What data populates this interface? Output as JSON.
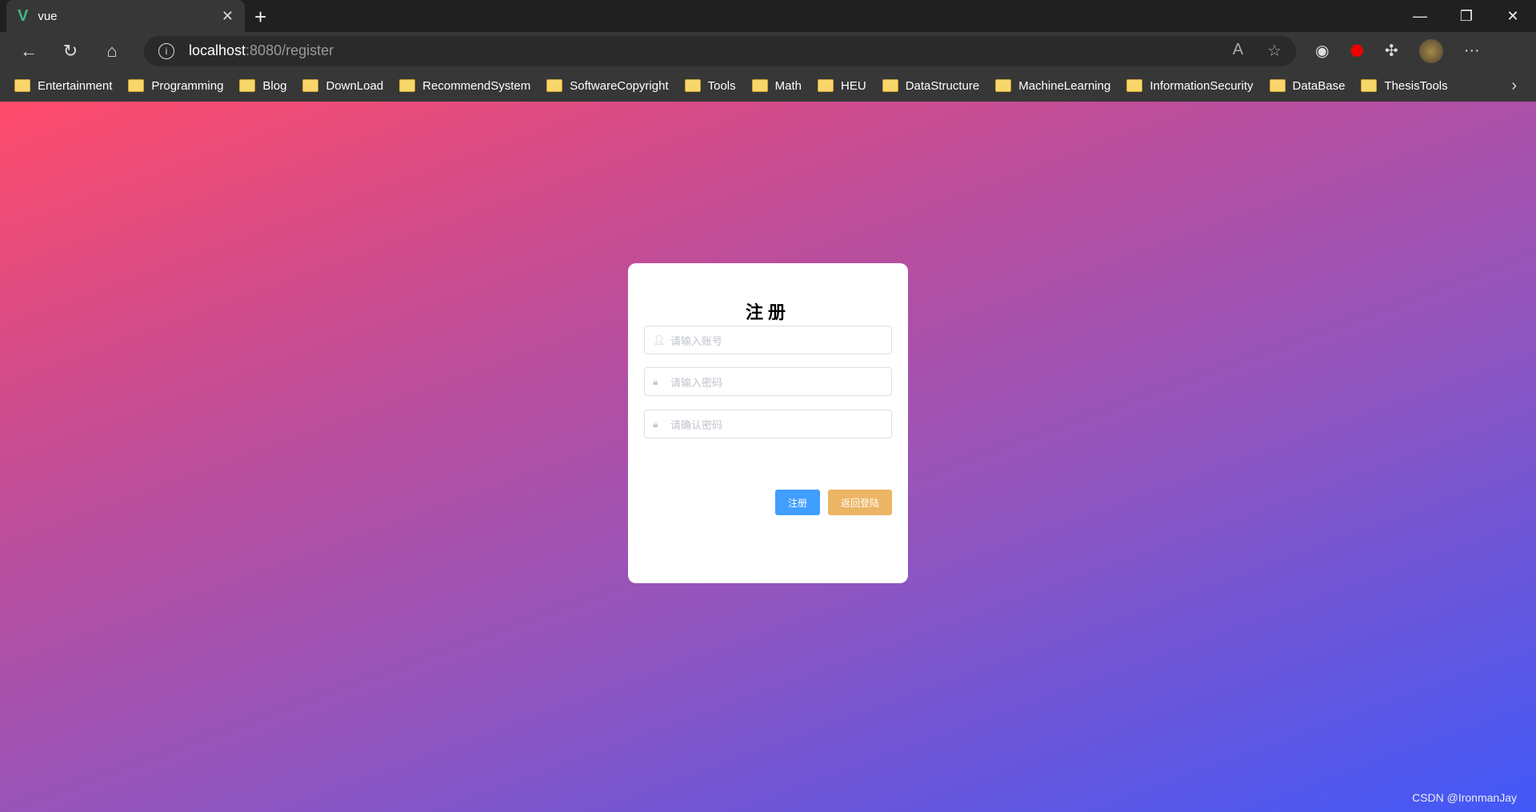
{
  "browser": {
    "tab_title": "vue",
    "url_host": "localhost",
    "url_rest": ":8080/register",
    "bookmarks": [
      "Entertainment",
      "Programming",
      "Blog",
      "DownLoad",
      "RecommendSystem",
      "SoftwareCopyright",
      "Tools",
      "Math",
      "HEU",
      "DataStructure",
      "MachineLearning",
      "InformationSecurity",
      "DataBase",
      "ThesisTools"
    ]
  },
  "form": {
    "title": "注册",
    "username_placeholder": "请输入账号",
    "password_placeholder": "请输入密码",
    "confirm_placeholder": "请确认密码",
    "register_label": "注册",
    "back_label": "返回登陆"
  },
  "watermark": "CSDN @IronmanJay",
  "colors": {
    "primary": "#409eff",
    "warning": "#ebb563"
  }
}
